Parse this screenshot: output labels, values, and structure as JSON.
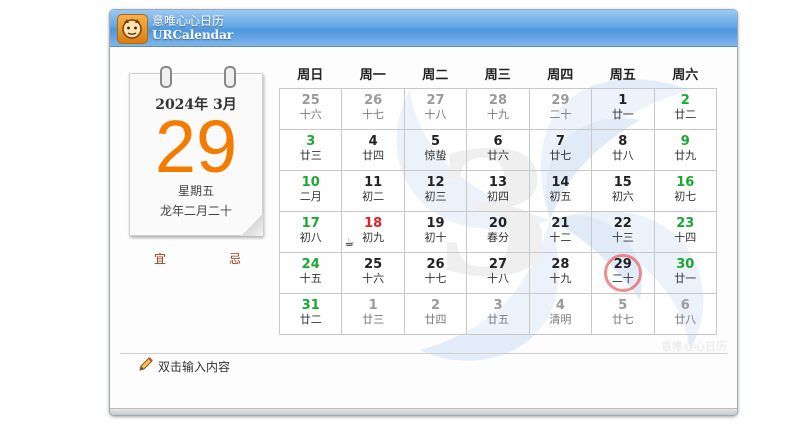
{
  "window": {
    "title_cn": "意唯心心日历",
    "title_en": "URCalendar",
    "accent_color": "#4f96dc"
  },
  "day_calendar": {
    "year_month": "2024年 3月",
    "day": "29",
    "weekday": "星期五",
    "lunar": "龙年二月二十",
    "day_color": "#f57b00"
  },
  "auspicious": {
    "yi": "宜",
    "ji": "忌"
  },
  "background_month": "3",
  "weekdays": [
    "周日",
    "周一",
    "周二",
    "周三",
    "周四",
    "周五",
    "周六"
  ],
  "weeks": [
    [
      {
        "d": "25",
        "l": "十六",
        "t": "oth"
      },
      {
        "d": "26",
        "l": "十七",
        "t": "oth"
      },
      {
        "d": "27",
        "l": "十八",
        "t": "oth"
      },
      {
        "d": "28",
        "l": "十九",
        "t": "oth"
      },
      {
        "d": "29",
        "l": "二十",
        "t": "oth"
      },
      {
        "d": "1",
        "l": "廿一",
        "t": ""
      },
      {
        "d": "2",
        "l": "廿二",
        "t": "wk"
      }
    ],
    [
      {
        "d": "3",
        "l": "廿三",
        "t": "wk"
      },
      {
        "d": "4",
        "l": "廿四",
        "t": ""
      },
      {
        "d": "5",
        "l": "惊蛰",
        "t": ""
      },
      {
        "d": "6",
        "l": "廿六",
        "t": ""
      },
      {
        "d": "7",
        "l": "廿七",
        "t": ""
      },
      {
        "d": "8",
        "l": "廿八",
        "t": ""
      },
      {
        "d": "9",
        "l": "廿九",
        "t": "wk"
      }
    ],
    [
      {
        "d": "10",
        "l": "二月",
        "t": "wk"
      },
      {
        "d": "11",
        "l": "初二",
        "t": ""
      },
      {
        "d": "12",
        "l": "初三",
        "t": ""
      },
      {
        "d": "13",
        "l": "初四",
        "t": ""
      },
      {
        "d": "14",
        "l": "初五",
        "t": ""
      },
      {
        "d": "15",
        "l": "初六",
        "t": ""
      },
      {
        "d": "16",
        "l": "初七",
        "t": "wk"
      }
    ],
    [
      {
        "d": "17",
        "l": "初八",
        "t": "wk"
      },
      {
        "d": "18",
        "l": "初九",
        "t": "hol"
      },
      {
        "d": "19",
        "l": "初十",
        "t": ""
      },
      {
        "d": "20",
        "l": "春分",
        "t": ""
      },
      {
        "d": "21",
        "l": "十二",
        "t": ""
      },
      {
        "d": "22",
        "l": "十三",
        "t": ""
      },
      {
        "d": "23",
        "l": "十四",
        "t": "wk"
      }
    ],
    [
      {
        "d": "24",
        "l": "十五",
        "t": "wk"
      },
      {
        "d": "25",
        "l": "十六",
        "t": ""
      },
      {
        "d": "26",
        "l": "十七",
        "t": ""
      },
      {
        "d": "27",
        "l": "十八",
        "t": ""
      },
      {
        "d": "28",
        "l": "十九",
        "t": ""
      },
      {
        "d": "29",
        "l": "二十",
        "t": "today"
      },
      {
        "d": "30",
        "l": "廿一",
        "t": "wk"
      }
    ],
    [
      {
        "d": "31",
        "l": "廿二",
        "t": "wk"
      },
      {
        "d": "1",
        "l": "廿三",
        "t": "oth"
      },
      {
        "d": "2",
        "l": "廿四",
        "t": "oth"
      },
      {
        "d": "3",
        "l": "廿五",
        "t": "oth"
      },
      {
        "d": "4",
        "l": "清明",
        "t": "oth"
      },
      {
        "d": "5",
        "l": "廿七",
        "t": "oth"
      },
      {
        "d": "6",
        "l": "廿八",
        "t": "oth"
      }
    ]
  ],
  "colors": {
    "weekend": "#1aa832",
    "holiday": "#e0202a",
    "other_month": "#9a9a9a",
    "today_ring": "#e65050"
  },
  "icons": {
    "app": "urcalendar-logo-icon",
    "note": "pencil-icon",
    "event": "coffee-cup-icon"
  },
  "watermark": "意唯心心日历",
  "note_prompt": "双击输入内容"
}
